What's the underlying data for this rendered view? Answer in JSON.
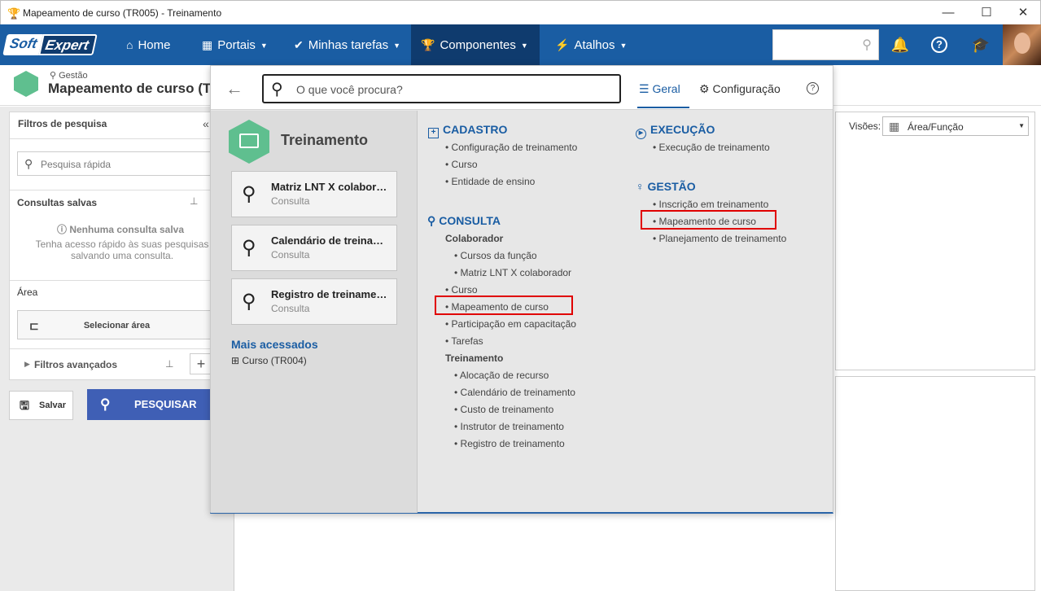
{
  "window": {
    "title": "Mapeamento de curso (TR005) - Treinamento",
    "minimize": "—",
    "maximize": "☐",
    "close": "✕"
  },
  "nav": {
    "logo1": "Soft",
    "logo2": "Expert",
    "items": [
      {
        "label": "Home",
        "icon": "home-icon",
        "glyph": "⌂"
      },
      {
        "label": "Portais",
        "icon": "grid-icon",
        "glyph": "▦"
      },
      {
        "label": "Minhas tarefas",
        "icon": "check-icon",
        "glyph": "✔"
      },
      {
        "label": "Componentes",
        "icon": "trophy-icon",
        "glyph": "🏆"
      },
      {
        "label": "Atalhos",
        "icon": "bolt-icon",
        "glyph": "⚡"
      }
    ]
  },
  "header": {
    "breadcrumb": "Gestão",
    "title": "Mapeamento de curso (TR"
  },
  "filters": {
    "title": "Filtros de pesquisa",
    "quick_search": "Pesquisa rápida",
    "saved_title": "Consultas salvas",
    "no_saved": "Nenhuma consulta salva",
    "saved_hint": "Tenha acesso rápido às suas pesquisas salvando uma consulta.",
    "area_title": "Área",
    "select_area": "Selecionar área",
    "advanced": "Filtros avançados",
    "save": "Salvar",
    "search": "PESQUISAR"
  },
  "views": {
    "label": "Visões:",
    "value": "Área/Função"
  },
  "popup": {
    "search_placeholder": "O que você procura?",
    "tab_geral": "Geral",
    "tab_config": "Configuração",
    "module": "Treinamento",
    "cards": [
      {
        "title": "Matriz LNT X colaborador",
        "subtitle": "Consulta"
      },
      {
        "title": "Calendário de treinamento",
        "subtitle": "Consulta"
      },
      {
        "title": "Registro de treinamento",
        "subtitle": "Consulta"
      }
    ],
    "most_accessed": "Mais acessados",
    "most_accessed_item": "Curso (TR004)",
    "cadastro": {
      "title": "CADASTRO",
      "items": [
        "Configuração de treinamento",
        "Curso",
        "Entidade de ensino"
      ]
    },
    "consulta": {
      "title": "CONSULTA",
      "colaborador": "Colaborador",
      "colab_items": [
        "Cursos da função",
        "Matriz LNT X colaborador"
      ],
      "items": [
        "Curso",
        "Mapeamento de curso",
        "Participação em capacitação",
        "Tarefas"
      ],
      "treinamento": "Treinamento",
      "trein_items": [
        "Alocação de recurso",
        "Calendário de treinamento",
        "Custo de treinamento",
        "Instrutor de treinamento",
        "Registro de treinamento"
      ]
    },
    "execucao": {
      "title": "EXECUÇÃO",
      "items": [
        "Execução de treinamento"
      ]
    },
    "gestao": {
      "title": "GESTÃO",
      "items": [
        "Inscrição em treinamento",
        "Mapeamento de curso",
        "Planejamento de treinamento"
      ]
    }
  },
  "colors": {
    "nav": "#1a5da3",
    "nav_active": "#0f3b6e",
    "accent": "#1a5da3",
    "module_green": "#5fbf8f",
    "highlight": "#e00000",
    "search_btn": "#3f5fb5"
  }
}
